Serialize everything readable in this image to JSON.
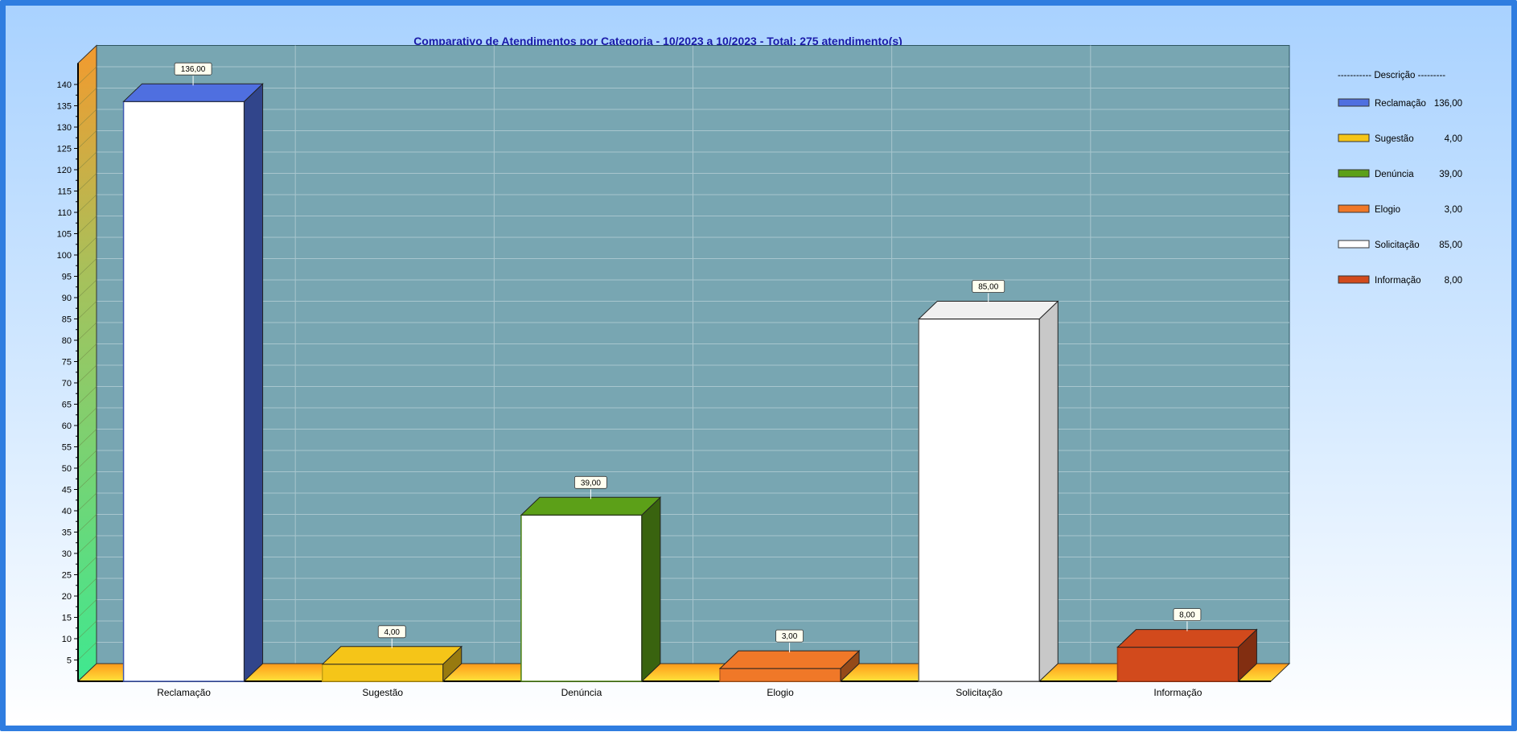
{
  "chart_data": {
    "type": "bar",
    "title": "Comparativo de Atendimentos por Categoria - 10/2023 a 10/2023 - Total: 275 atendimento(s)",
    "xlabel": "",
    "ylabel": "",
    "ylim": [
      0,
      145
    ],
    "yticks": [
      5,
      10,
      15,
      20,
      25,
      30,
      35,
      40,
      45,
      50,
      55,
      60,
      65,
      70,
      75,
      80,
      85,
      90,
      95,
      100,
      105,
      110,
      115,
      120,
      125,
      130,
      135,
      140
    ],
    "grid": true,
    "legend_position": "right",
    "legend_title": "----------- Descrição ---------",
    "categories": [
      "Reclamação",
      "Sugestão",
      "Denúncia",
      "Elogio",
      "Solicitação",
      "Informação"
    ],
    "values": [
      136,
      4,
      39,
      3,
      85,
      8
    ],
    "value_labels": [
      "136,00",
      "4,00",
      "39,00",
      "3,00",
      "85,00",
      "8,00"
    ],
    "colors": [
      "#4f6fe0",
      "#f5c518",
      "#5ca018",
      "#f07828",
      "#ffffff",
      "#d24a1c"
    ]
  }
}
